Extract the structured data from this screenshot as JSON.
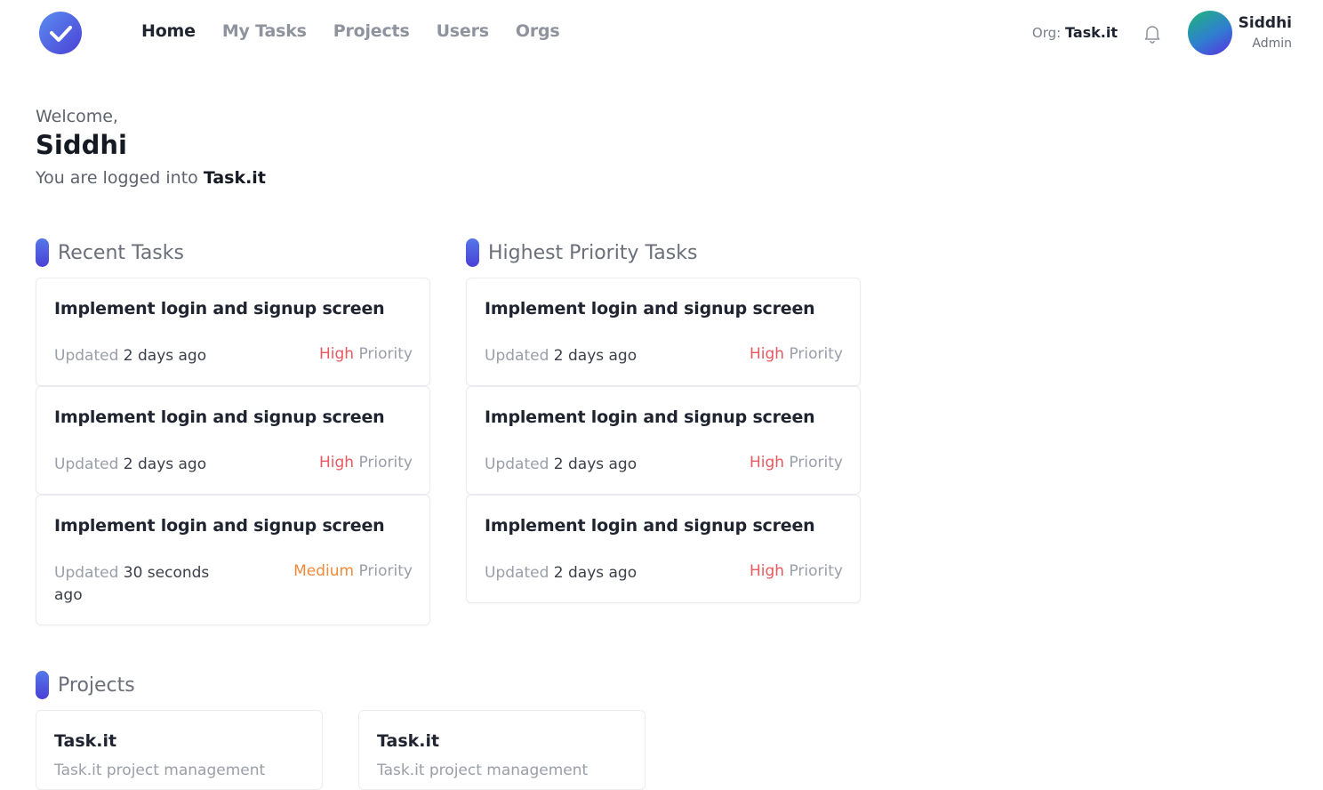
{
  "nav": {
    "links": [
      "Home",
      "My Tasks",
      "Projects",
      "Users",
      "Orgs"
    ],
    "org_label": "Org:",
    "org_name": "Task.it",
    "user_name": "Siddhi",
    "user_role": "Admin"
  },
  "welcome": {
    "greeting": "Welcome,",
    "name": "Siddhi",
    "logged_prefix": "You are logged into",
    "logged_org": "Task.it"
  },
  "recent_tasks": {
    "title": "Recent Tasks",
    "items": [
      {
        "title": "Implement login and signup screen",
        "updated_label": "Updated",
        "updated": "2 days ago",
        "priority": "High",
        "priority_suffix": "Priority"
      },
      {
        "title": "Implement login and signup screen",
        "updated_label": "Updated",
        "updated": "2 days ago",
        "priority": "High",
        "priority_suffix": "Priority"
      },
      {
        "title": "Implement login and signup screen",
        "updated_label": "Updated",
        "updated": "30 seconds ago",
        "priority": "Medium",
        "priority_suffix": "Priority"
      }
    ]
  },
  "priority_tasks": {
    "title": "Highest Priority Tasks",
    "items": [
      {
        "title": "Implement login and signup screen",
        "updated_label": "Updated",
        "updated": "2 days ago",
        "priority": "High",
        "priority_suffix": "Priority"
      },
      {
        "title": "Implement login and signup screen",
        "updated_label": "Updated",
        "updated": "2 days ago",
        "priority": "High",
        "priority_suffix": "Priority"
      },
      {
        "title": "Implement login and signup screen",
        "updated_label": "Updated",
        "updated": "2 days ago",
        "priority": "High",
        "priority_suffix": "Priority"
      }
    ]
  },
  "projects": {
    "title": "Projects",
    "items": [
      {
        "name": "Task.it",
        "description": "Task.it project management"
      },
      {
        "name": "Task.it",
        "description": "Task.it project management"
      }
    ]
  },
  "colors": {
    "accent": "#4a40d6",
    "priority_high": "#e8585e",
    "priority_medium": "#ef8a3c"
  },
  "icons": {
    "logo": "check-icon",
    "notifications": "bell-icon"
  }
}
